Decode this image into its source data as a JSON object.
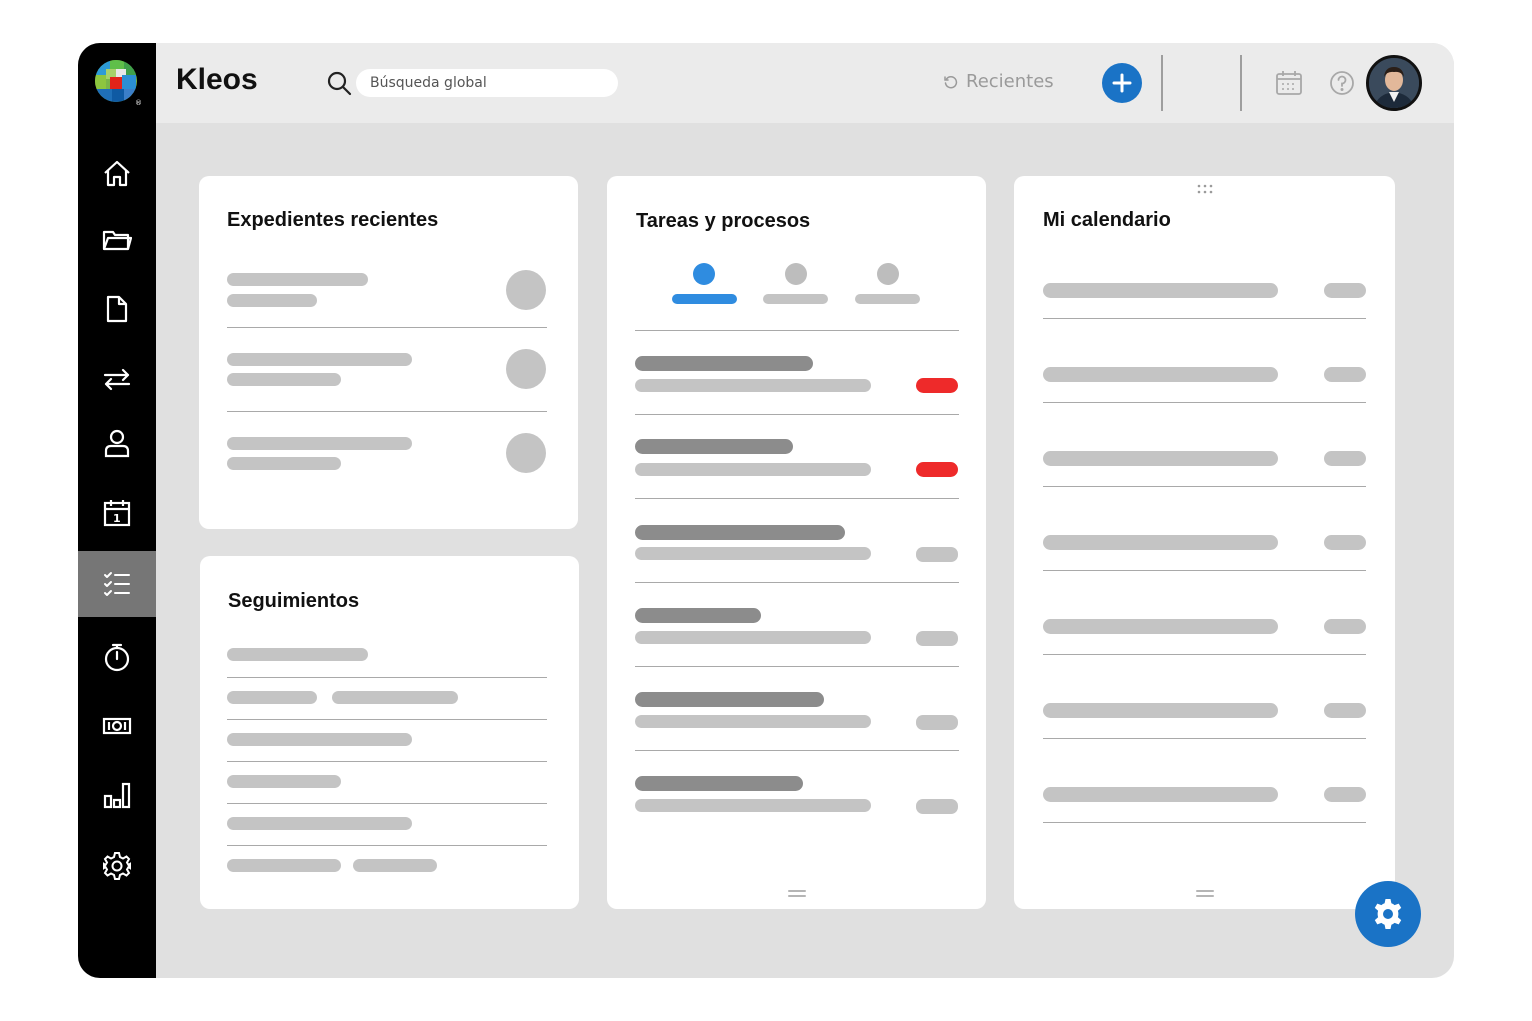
{
  "app": {
    "title": "Kleos",
    "brand_color": "#1a73c6"
  },
  "header": {
    "search": {
      "placeholder": "Búsqueda global"
    },
    "recents_label": "Recientes",
    "icons": [
      "calendar-icon",
      "help-icon",
      "bell-icon"
    ]
  },
  "sidebar": {
    "items": [
      {
        "icon": "home-icon"
      },
      {
        "icon": "folder-icon"
      },
      {
        "icon": "document-icon"
      },
      {
        "icon": "transfer-icon"
      },
      {
        "icon": "user-icon"
      },
      {
        "icon": "calendar-icon"
      },
      {
        "icon": "tasks-icon",
        "active": true
      },
      {
        "icon": "stopwatch-icon"
      },
      {
        "icon": "money-icon"
      },
      {
        "icon": "bar-chart-icon"
      },
      {
        "icon": "gear-icon"
      }
    ]
  },
  "cards": {
    "recent_files": {
      "title": "Expedientes recientes"
    },
    "follow_ups": {
      "title": "Seguimientos"
    },
    "tasks": {
      "title": "Tareas y procesos",
      "active_tab": 0,
      "status_colors": [
        "#ee2a2a",
        "#ee2a2a",
        "#c4c4c4",
        "#c4c4c4",
        "#c4c4c4",
        "#c4c4c4"
      ]
    },
    "calendar": {
      "title": "Mi calendario"
    }
  }
}
